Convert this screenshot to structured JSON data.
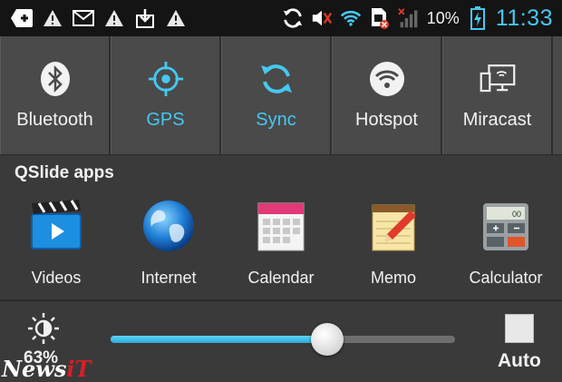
{
  "status_bar": {
    "left_icons": [
      "add-icon",
      "warning-icon",
      "gmail-icon",
      "warning-icon",
      "download-icon",
      "warning-icon"
    ],
    "battery_percent": "10%",
    "time": "11:33"
  },
  "toggles": [
    {
      "label": "Bluetooth",
      "icon": "bluetooth-icon",
      "state": "off"
    },
    {
      "label": "GPS",
      "icon": "gps-icon",
      "state": "on"
    },
    {
      "label": "Sync",
      "icon": "sync-icon",
      "state": "on"
    },
    {
      "label": "Hotspot",
      "icon": "hotspot-icon",
      "state": "off"
    },
    {
      "label": "Miracast",
      "icon": "miracast-icon",
      "state": "off"
    }
  ],
  "qslide": {
    "title": "QSlide apps",
    "apps": [
      {
        "label": "Videos",
        "icon": "videos-icon"
      },
      {
        "label": "Internet",
        "icon": "internet-icon"
      },
      {
        "label": "Calendar",
        "icon": "calendar-icon"
      },
      {
        "label": "Memo",
        "icon": "memo-icon"
      },
      {
        "label": "Calculator",
        "icon": "calculator-icon"
      }
    ]
  },
  "brightness": {
    "percent_label": "63%",
    "level": 0.63,
    "auto_label": "Auto",
    "auto_checked": false
  },
  "colors": {
    "accent": "#45c8f0",
    "status_bar_bg": "#141414",
    "panel_bg": "#3a3a3a"
  },
  "watermark": {
    "text": "News",
    "suffix": "iT"
  }
}
